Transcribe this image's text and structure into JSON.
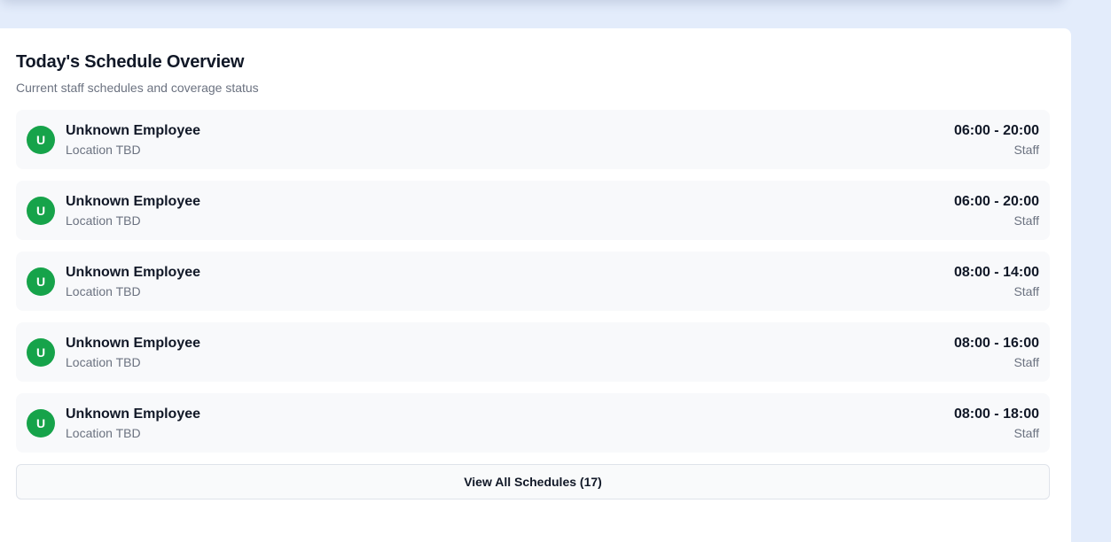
{
  "panel": {
    "title": "Today's Schedule Overview",
    "subtitle": "Current staff schedules and coverage status"
  },
  "schedules": [
    {
      "initial": "U",
      "name": "Unknown Employee",
      "location": "Location TBD",
      "time": "06:00 - 20:00",
      "role": "Staff"
    },
    {
      "initial": "U",
      "name": "Unknown Employee",
      "location": "Location TBD",
      "time": "06:00 - 20:00",
      "role": "Staff"
    },
    {
      "initial": "U",
      "name": "Unknown Employee",
      "location": "Location TBD",
      "time": "08:00 - 14:00",
      "role": "Staff"
    },
    {
      "initial": "U",
      "name": "Unknown Employee",
      "location": "Location TBD",
      "time": "08:00 - 16:00",
      "role": "Staff"
    },
    {
      "initial": "U",
      "name": "Unknown Employee",
      "location": "Location TBD",
      "time": "08:00 - 18:00",
      "role": "Staff"
    }
  ],
  "view_all_label": "View All Schedules (17)",
  "colors": {
    "avatar": "#16a34a",
    "page_background": "#e3ecfb",
    "row_background": "#f8f9fb"
  }
}
